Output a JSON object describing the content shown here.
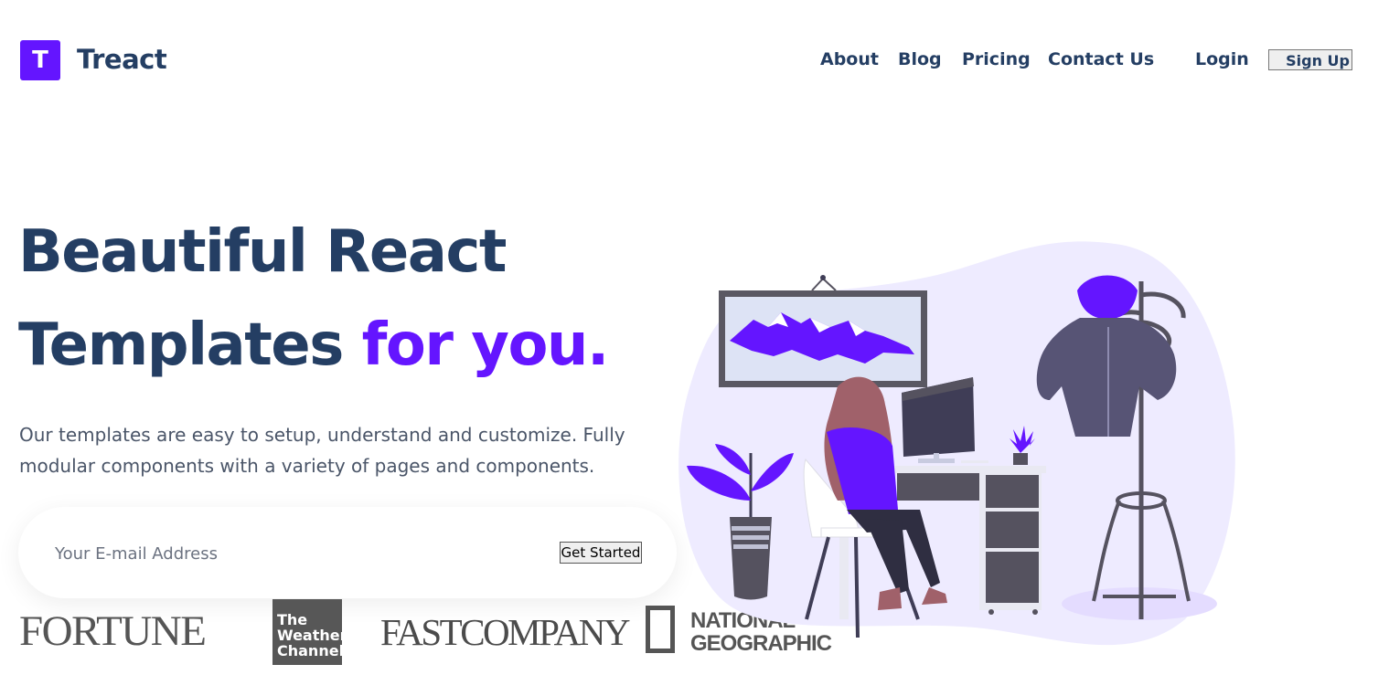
{
  "brand": {
    "logo_letter": "T",
    "name": "Treact"
  },
  "nav": {
    "links": [
      "About",
      "Blog",
      "Pricing",
      "Contact Us"
    ],
    "login": "Login",
    "signup": "Sign Up"
  },
  "hero": {
    "headline_line1": "Beautiful React",
    "headline_line2_start": "Templates ",
    "headline_line2_accent": "for you.",
    "description": "Our templates are easy to setup, understand and customize. Fully modular components with a variety of pages and components.",
    "email_placeholder": "Your E-mail Address",
    "cta": "Get Started"
  },
  "press_logos": {
    "fortune": "FORTUNE",
    "weather_channel_lines": [
      "The",
      "Weather",
      "Channel"
    ],
    "fast_company": "FASTCOMPANY",
    "national_geographic_lines": [
      "NATIONAL",
      "GEOGRAPHIC"
    ]
  },
  "colors": {
    "primary": "#6415ff",
    "heading": "#243e63",
    "body_text": "#4a5568",
    "illustration_bg": "#eeebff"
  }
}
